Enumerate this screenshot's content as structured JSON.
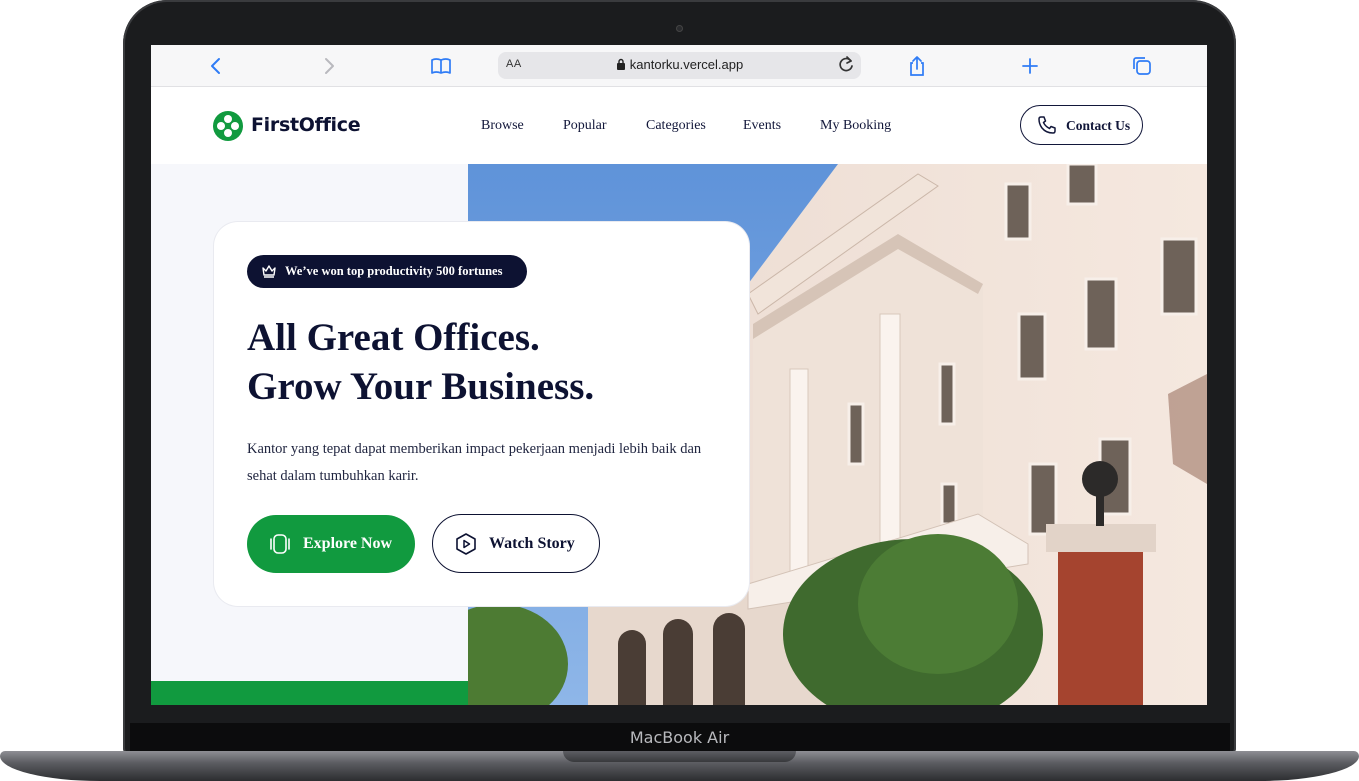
{
  "device": {
    "model_label": "MacBook Air"
  },
  "browser": {
    "text_size_label": "AA",
    "url": "kantorku.vercel.app",
    "icons": [
      "back-icon",
      "forward-icon",
      "bookmarks-icon",
      "lock-icon",
      "reload-icon",
      "share-icon",
      "new-tab-icon",
      "tabs-icon"
    ]
  },
  "site": {
    "brand": "FirstOffice",
    "nav": [
      "Browse",
      "Popular",
      "Categories",
      "Events",
      "My Booking"
    ],
    "contact_label": "Contact Us"
  },
  "hero": {
    "badge": "We’ve won top productivity 500 fortunes",
    "headline_line1": "All Great Offices.",
    "headline_line2": "Grow Your Business.",
    "description": "Kantor yang tepat dapat memberikan impact pekerjaan menjadi lebih baik dan sehat dalam tumbuhkan karir.",
    "primary_cta": "Explore Now",
    "secondary_cta": "Watch Story"
  },
  "colors": {
    "brand_green": "#119a3f",
    "navy": "#0d1232",
    "hero_bg": "#f6f7fb"
  }
}
